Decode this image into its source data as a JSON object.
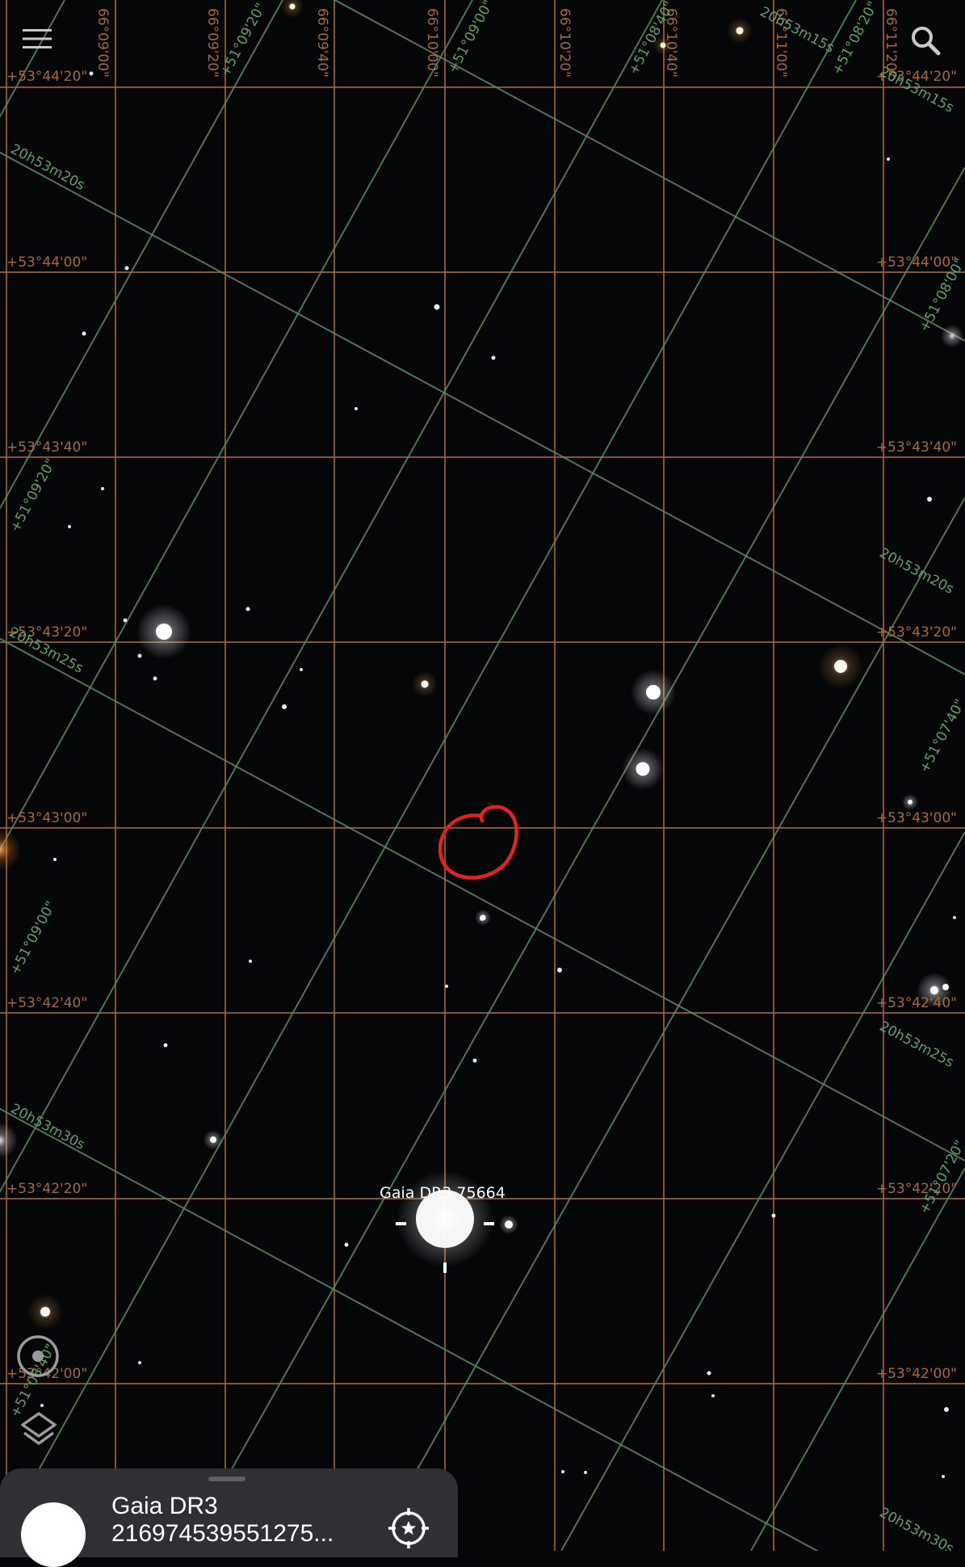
{
  "app": {
    "icons": {
      "menu": "hamburger-menu-icon",
      "search": "search-icon",
      "target": "target-icon",
      "layers": "layers-icon",
      "center": "crosshair-star-icon"
    }
  },
  "sky_map": {
    "dec_labels_left": [
      "+53°44'20\"",
      "+53°44'00\"",
      "+53°43'40\"",
      "+53°43'20\"",
      "+53°43'00\"",
      "+53°42'40\"",
      "+53°42'20\"",
      "+53°42'00\""
    ],
    "dec_labels_right": [
      "+53°44'20\"",
      "+53°44'00\"",
      "+53°43'40\"",
      "+53°43'20\"",
      "+53°43'00\"",
      "+53°42'40\"",
      "+53°42'20\"",
      "+53°42'00\""
    ],
    "top_labels": [
      "66°09'00\"",
      "66°09'20\"",
      "66°09'40\"",
      "66°10'00\"",
      "66°10'20\"",
      "66°10'40\"",
      "66°11'00\"",
      "66°11'20\""
    ],
    "eq_grid_labels": [
      "20h53m15s",
      "20h53m15s",
      "20h53m20s",
      "20h53m20s",
      "20h53m25s",
      "20h53m25s",
      "20h53m30s",
      "20h53m30s",
      "+51°09'20\"",
      "+51°09'20\"",
      "+51°09'00\"",
      "+51°08'40\"",
      "+51°08'40\"",
      "+51°08'20\"",
      "+51°08'00\"",
      "+51°07'40\"",
      "+51°07'20\"",
      "+51°09'00\""
    ],
    "selected_label": "Gaia DR3 75664",
    "colors": {
      "background": "#050608",
      "alt_az_grid": "#a0612e",
      "equatorial_grid": "#5a8a5e",
      "annotation": "#e0241c"
    }
  },
  "selection_sheet": {
    "title": "Gaia DR3",
    "object_id": "216974539551275..."
  }
}
